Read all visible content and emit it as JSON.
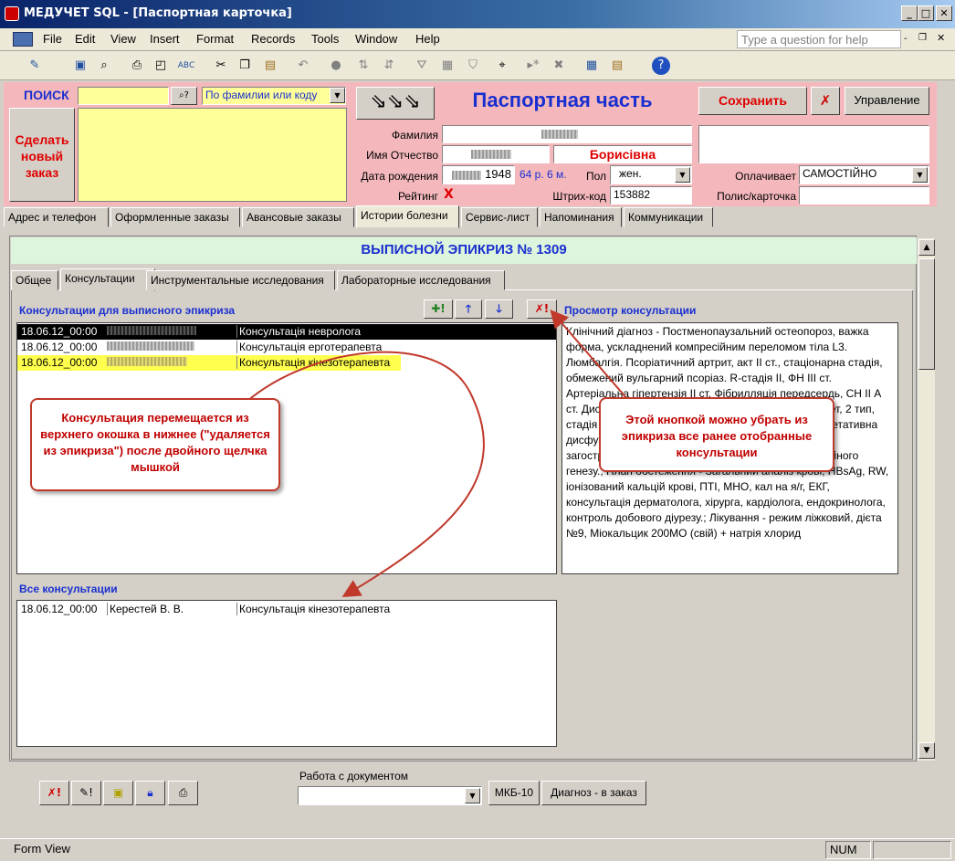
{
  "window": {
    "title": "МЕДУЧЕТ SQL - [Паспортная карточка]"
  },
  "menu": [
    "File",
    "Edit",
    "View",
    "Insert",
    "Format",
    "Records",
    "Tools",
    "Window",
    "Help"
  ],
  "help_placeholder": "Type a question for help",
  "search": {
    "label": "ПОИСК",
    "value": "",
    "mode": "По фамилии или коду"
  },
  "new_order_button": "Сделать\nновый\nзаказ",
  "header": {
    "title": "Паспортная часть",
    "save": "Сохранить",
    "manage": "Управление",
    "surname_label": "Фамилия",
    "name_label": "Имя Отчество",
    "patronymic": "Борисівна",
    "dob_label": "Дата рождения",
    "dob_year": "1948",
    "age": "64 р. 6 м.",
    "sex_label": "Пол",
    "sex_value": "жен.",
    "payer_label": "Оплачивает",
    "payer_value": "САМОСТІЙНО",
    "rating_label": "Рейтинг",
    "rating_value": "X",
    "barcode_label": "Штрих-код",
    "barcode_value": "153882",
    "policy_label": "Полис/карточка"
  },
  "main_tabs": [
    "Адрес и телефон",
    "Оформленные заказы",
    "Авансовые заказы",
    "Истории болезни",
    "Сервис-лист",
    "Напоминания",
    "Коммуникации"
  ],
  "epicrisis_title": "ВЫПИСНОЙ ЭПИКРИЗ № 1309",
  "sub_tabs": [
    "Общее",
    "Консультации",
    "Инструментальные исследования",
    "Лабораторные исследования"
  ],
  "consult_epicrisis_label": "Консультации для выписного эпикриза",
  "consult_view_label": "Просмотр консультации",
  "epicrisis_rows": [
    {
      "date": "18.06.12_00:00",
      "name": "Консультація невролога"
    },
    {
      "date": "18.06.12_00:00",
      "name": "Консультація ерготерапевта"
    },
    {
      "date": "18.06.12_00:00",
      "name": "Консультація кінезотерапевта"
    }
  ],
  "consult_text": "Клінічний діагноз - Постменопаузальний остеопороз, важка форма, ускладнений компресійним переломом тіла L3. Люмбалгія. Псоріатичний артрит, акт II ст., стаціонарна стадія, обмежений вульгарний псоріаз. R-стадія II, ФН III ст. Артеріальна гіпертензія II ст. Фібрилляція передсердь, СН II А ст. Дисциркуляторна енцефалопатія. Цукровий діабет, 2 тип, стадія компенсації. Ангіосклероз нижніх кінцівок, вегетативна дисфункція. Мікробна екзема гомілок та стоп, стадія загострення. Ожиріння II ст, аліментарно-конституційного генезу.; План обстеження - Загальний аналіз крові, HBsAg, RW, іонізований кальцій крові, ПТІ, МНО, кал на я/г, ЕКГ, консультація дерматолога, хірурга, кардіолога, ендокринолога, контроль добового діурезу.; Лікування - режим ліжковий, дієта №9, Міокальцик 200МО (свій) + натрія хлорид",
  "all_consult_label": "Все консультации",
  "all_consult_rows": [
    {
      "date": "18.06.12_00:00",
      "doctor": "Керестей В. В.",
      "name": "Консультація кінезотерапевта"
    }
  ],
  "callouts": {
    "left": "Консультация перемещается из верхнего окошка в нижнее (\"удаляется из эпикриза\") после двойного щелчка мышкой",
    "right": "Этой кнопкой можно убрать из эпикриза все ранее отобранные консультации"
  },
  "bottom": {
    "doc_work_label": "Работа с документом",
    "mkb_button": "МКБ-10",
    "diag_button": "Диагноз - в заказ"
  },
  "status": {
    "left": "Form View",
    "num": "NUM"
  }
}
